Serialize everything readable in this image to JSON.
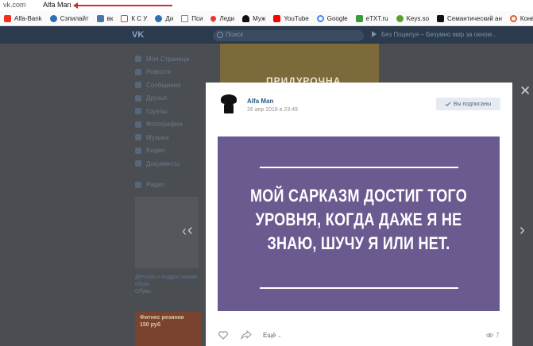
{
  "browser": {
    "domain": "vk.com",
    "page_title": "Alfa Man"
  },
  "bookmarks": [
    {
      "label": "Alfa-Bank",
      "icon": "alfa-bank-icon"
    },
    {
      "label": "Сэпилайт",
      "icon": "sepilight-icon"
    },
    {
      "label": "вк",
      "icon": "vk-icon"
    },
    {
      "label": "К С У",
      "icon": "gmail-icon"
    },
    {
      "label": "Ди",
      "icon": "di-icon"
    },
    {
      "label": "Пси",
      "icon": "file-icon"
    },
    {
      "label": "Леди",
      "icon": "heart-icon"
    },
    {
      "label": "Муж",
      "icon": "man-icon"
    },
    {
      "label": "YouTube",
      "icon": "youtube-icon"
    },
    {
      "label": "Google",
      "icon": "google-icon"
    },
    {
      "label": "eTXT.ru",
      "icon": "etxt-icon"
    },
    {
      "label": "Keys.so",
      "icon": "keys-icon"
    },
    {
      "label": "Семантический ан",
      "icon": "a-icon"
    },
    {
      "label": "Конвертер",
      "icon": "converter-icon"
    }
  ],
  "vk": {
    "search_placeholder": "Поиск",
    "now_playing": "Без Поцелуя – Безумно мир за окном...",
    "left_menu": [
      {
        "label": "Моя Страница",
        "icon": "home-icon"
      },
      {
        "label": "Новости",
        "icon": "news-icon"
      },
      {
        "label": "Сообщения",
        "icon": "messages-icon"
      },
      {
        "label": "Друзья",
        "icon": "friends-icon"
      },
      {
        "label": "Группы",
        "icon": "groups-icon"
      },
      {
        "label": "Фотографии",
        "icon": "photos-icon"
      },
      {
        "label": "Музыка",
        "icon": "music-icon"
      },
      {
        "label": "Видео",
        "icon": "video-icon"
      },
      {
        "label": "Документы",
        "icon": "documents-icon"
      }
    ],
    "left_menu_extra": {
      "label": "Радио",
      "icon": "radio-icon"
    },
    "bg_poster_text": "ПРИДУРОЧНА",
    "ad": {
      "title": "Детская и подростковая обувь",
      "subtitle": "Обувь",
      "promo_text": "Фитнес резинки",
      "promo_sub": "150 руб"
    }
  },
  "post": {
    "author": "Alfa Man",
    "date": "26 апр 2018 в 23:49",
    "subscribed_label": "Вы подписаны",
    "image_text": [
      "МОЙ САРКАЗМ ДОСТИГ ТОГО",
      "УРОВНЯ, КОГДА ДАЖЕ Я НЕ",
      "ЗНАЮ, ШУЧУ Я ИЛИ НЕТ."
    ],
    "more_label": "Ещё",
    "views": "7"
  },
  "colors": {
    "post_bg": "#6b5a90",
    "vk_header": "#2b3a4d",
    "link": "#2a5885",
    "arrow": "#d72b2b"
  }
}
